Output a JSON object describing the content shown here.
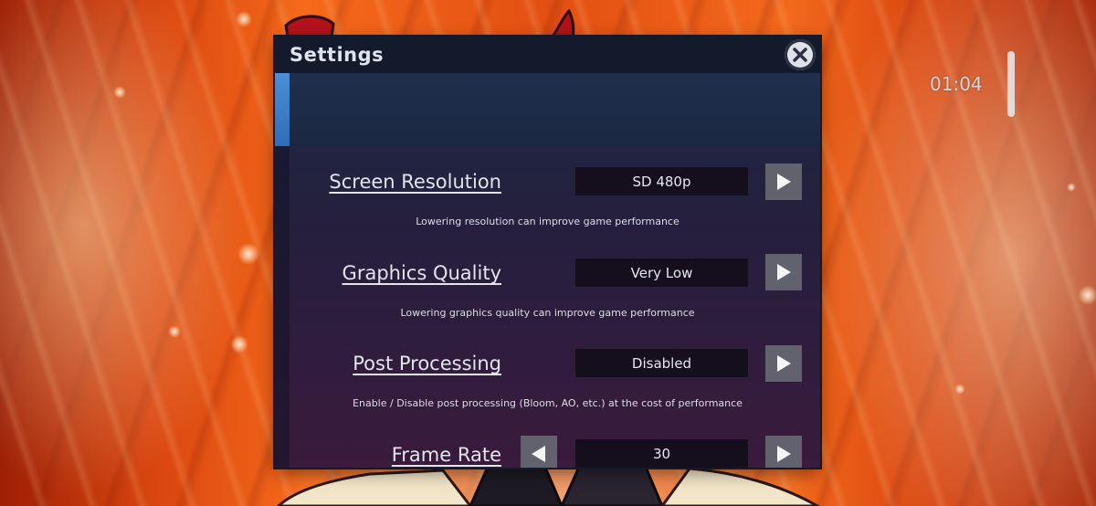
{
  "hud": {
    "timer": "01:04"
  },
  "settings_panel": {
    "title": "Settings",
    "close_icon": "close-icon",
    "rows": [
      {
        "label": "Screen Resolution",
        "value": "SD 480p",
        "description": "Lowering resolution can improve game performance"
      },
      {
        "label": "Graphics Quality",
        "value": "Very Low",
        "description": "Lowering graphics quality can improve game performance"
      },
      {
        "label": "Post Processing",
        "value": "Disabled",
        "description": "Enable / Disable post processing (Bloom, AO, etc.) at the cost of performance"
      },
      {
        "label": "Frame Rate",
        "value": "30",
        "description": ""
      }
    ]
  },
  "colors": {
    "panel_top": "#1d2a45",
    "panel_bottom": "#3a1a3d",
    "tab_accent": "#4a8fd8",
    "value_box": "#150f1d",
    "arrow_button": "#62616e",
    "background_orange": "#f56a1b"
  }
}
